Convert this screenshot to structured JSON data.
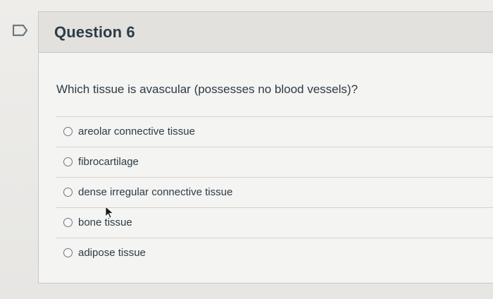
{
  "question": {
    "title": "Question 6",
    "text": "Which tissue is avascular (possesses no blood vessels)?",
    "answers": [
      {
        "label": "areolar connective tissue"
      },
      {
        "label": "fibrocartilage"
      },
      {
        "label": "dense irregular connective tissue"
      },
      {
        "label": "bone tissue"
      },
      {
        "label": "adipose tissue"
      }
    ]
  },
  "icons": {
    "flag": "flag-icon",
    "cursor": "mouse-pointer-icon"
  }
}
